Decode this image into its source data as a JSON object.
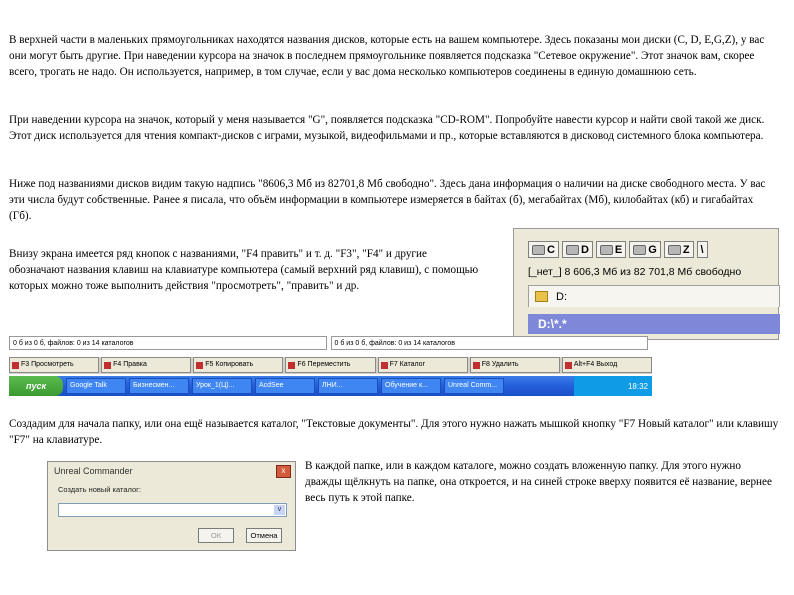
{
  "paragraphs": {
    "p1": "В верхней части в маленьких прямоугольниках находятся названия дисков, которые есть на вашем компьютере. Здесь показаны мои диски (C, D, E,G,Z), у вас они могут быть другие. При наведении курсора на значок в последнем прямоугольнике появляется подсказка \"Сетевое окружение\". Этот значок вам, скорее всего, трогать не надо. Он используется, например, в том случае, если у вас дома несколько компьютеров соединены в единую домашнюю сеть.",
    "p2": "При наведении курсора на значок, который у меня называется \"G\", появляется подсказка \"CD-ROM\". Попробуйте навести курсор и найти свой такой же диск. Этот диск используется для чтения компакт-дисков с играми, музыкой, видеофильмами и пр., которые вставляются в дисковод системного блока компьютера.",
    "p3": "Ниже под названиями дисков видим такую надпись \"8606,3 Мб из 82701,8 Мб свободно\". Здесь дана информация о наличии на диске свободного места. У вас эти числа будут собственные. Ранее я писала, что объём информации в компьютере измеряется в байтах (б), мегабайтах (Мб), килобайтах (кб) и гигабайтах (Гб).",
    "p4": "Внизу экрана имеется ряд кнопок с названиями, \"F4 править\" и т. д. \"F3\", \"F4\" и другие обозначают названия клавиш на клавиатуре компьютера (самый верхний ряд клавиш), с помощью которых можно тоже выполнить действия \"просмотреть\", \"править\" и др.",
    "p5": "Создадим для начала папку, или она ещё называется каталог, \"Текстовые документы\". Для этого нужно нажать мышкой кнопку \"F7 Новый каталог\" или клавишу \"F7\" на клавиатуре.",
    "p6": "В каждой папке, или в каждом каталоге, можно создать вложенную папку. Для этого нужно дважды щёлкнуть на папке, она откроется, и на синей строке вверху появится её название, вернее весь путь к этой папке."
  },
  "drive_panel": {
    "drives": [
      "C",
      "D",
      "E",
      "G",
      "Z",
      "\\"
    ],
    "space_text": "[_нет_]  8 606,3 Мб из  82 701,8 Мб свободно",
    "tab_label": "D:",
    "path": "D:\\*.*"
  },
  "fkey_strip": {
    "status": [
      "0 б из 0 б, файлов: 0 из 14 каталогов",
      "0 б из 0 б, файлов: 0 из 14 каталогов"
    ],
    "keys": [
      "F3 Просмотреть",
      "F4 Правка",
      "F5 Копировать",
      "F6 Переместить",
      "F7 Каталог",
      "F8 Удалить",
      "Alt+F4 Выход"
    ],
    "start": "пуск",
    "tasks": [
      "Google Talk",
      "Бизнесмен...",
      "Урок_1(Ц)...",
      "AcdSee",
      "ЛНИ...",
      "Обучение к...",
      "Unreal Comm..."
    ],
    "tray": "18:32"
  },
  "dialog": {
    "title": "Unreal Commander",
    "close": "x",
    "label": "Создать новый каталог:",
    "arrow": "v",
    "ok": "ОК",
    "cancel": "Отмена"
  }
}
